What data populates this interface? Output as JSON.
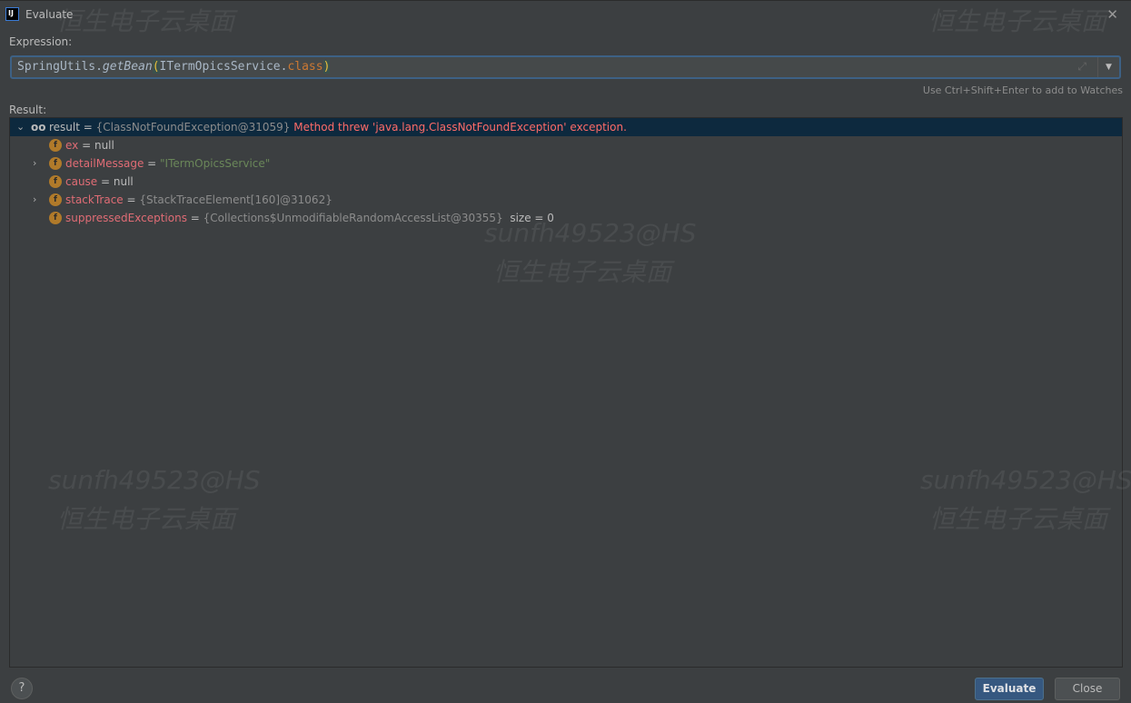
{
  "window": {
    "title": "Evaluate",
    "logo": "IJ"
  },
  "expression": {
    "label": "Expression:",
    "parts": {
      "object": "SpringUtils.",
      "method": "getBean",
      "open": "(",
      "arg": "ITermOpicsService.",
      "kw": "class",
      "close": ")"
    },
    "hint": "Use Ctrl+Shift+Enter to add to Watches"
  },
  "result": {
    "label": "Result:",
    "root": {
      "name": "result",
      "eq": " = ",
      "value": "{ClassNotFoundException@31059}",
      "error": "Method threw 'java.lang.ClassNotFoundException' exception."
    },
    "fields": [
      {
        "name": "ex",
        "eq": " = ",
        "value": "null",
        "expandable": false
      },
      {
        "name": "detailMessage",
        "eq": " = ",
        "value": "\"ITermOpicsService\"",
        "expandable": true
      },
      {
        "name": "cause",
        "eq": " = ",
        "value": "null",
        "expandable": false
      },
      {
        "name": "stackTrace",
        "eq": " = ",
        "value": "{StackTraceElement[160]@31062}",
        "expandable": true
      },
      {
        "name": "suppressedExceptions",
        "eq": " = ",
        "value": "{Collections$UnmodifiableRandomAccessList@30355}",
        "extra": "size = 0",
        "expandable": false
      }
    ]
  },
  "buttons": {
    "evaluate": "Evaluate",
    "close": "Close",
    "help": "?"
  },
  "watermark": {
    "user": "sunfh49523@HS",
    "text": "恒生电子云桌面"
  },
  "colors": {
    "accent": "#365880",
    "selection": "#0d293e",
    "error": "#ff6b68"
  }
}
